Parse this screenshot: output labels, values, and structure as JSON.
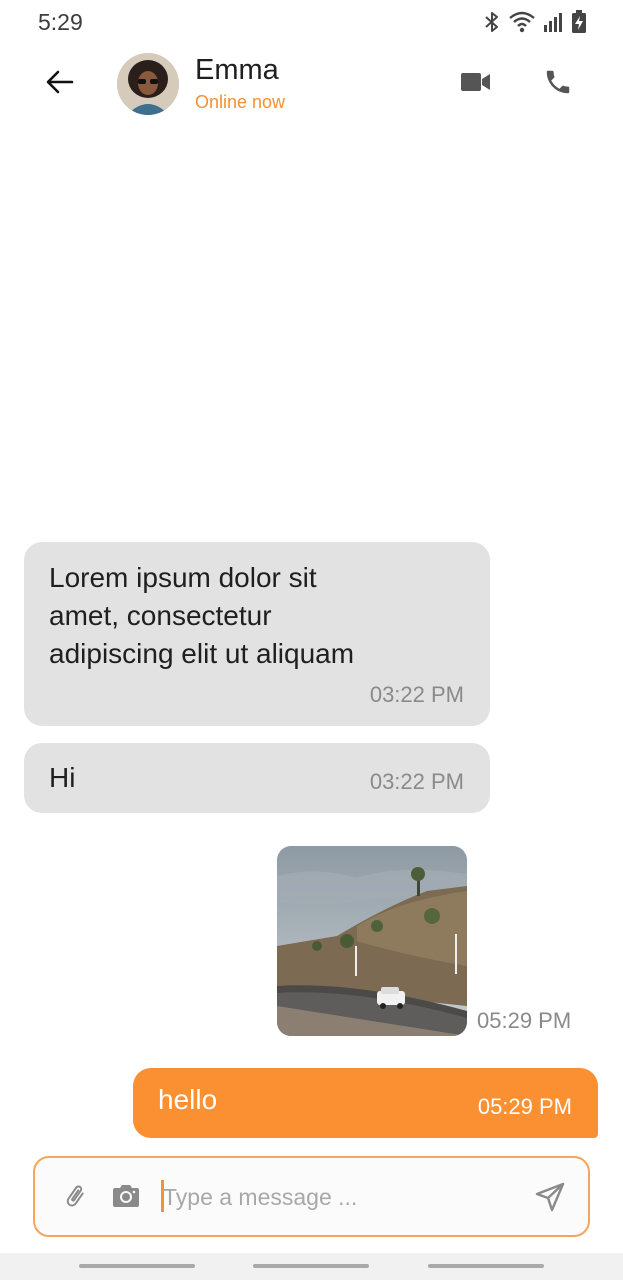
{
  "status_bar": {
    "time": "5:29",
    "icons": [
      "bluetooth-icon",
      "wifi-icon",
      "signal-icon",
      "battery-charging-icon"
    ]
  },
  "header": {
    "contact_name": "Emma",
    "contact_status": "Online now",
    "icons": {
      "back": "arrow-left-icon",
      "video": "video-camera-icon",
      "call": "phone-icon"
    }
  },
  "messages": [
    {
      "direction": "incoming",
      "type": "text",
      "text": "Lorem ipsum dolor sit amet, consectetur adipiscing elit ut aliquam",
      "time": "03:22 PM"
    },
    {
      "direction": "incoming",
      "type": "text",
      "text": "Hi",
      "time": "03:22 PM"
    },
    {
      "direction": "outgoing",
      "type": "image",
      "time": "05:29 PM"
    },
    {
      "direction": "outgoing",
      "type": "text",
      "text": "hello",
      "time": "05:29 PM"
    }
  ],
  "composer": {
    "placeholder": "Type a message ...",
    "value": "",
    "icons": {
      "attach": "paperclip-icon",
      "camera": "camera-icon",
      "send": "send-icon"
    }
  },
  "colors": {
    "accent": "#fb9032",
    "status_text": "#f49131",
    "incoming_bubble": "#e2e2e2",
    "input_border": "#f6a55b"
  }
}
